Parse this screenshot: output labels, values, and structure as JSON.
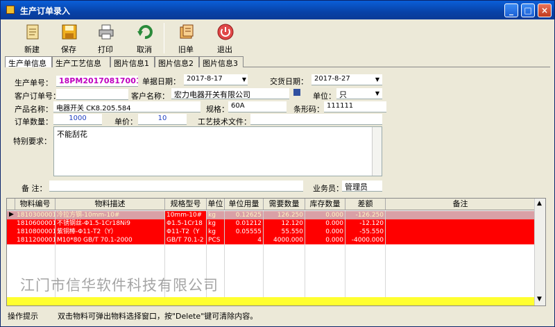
{
  "window": {
    "title": "生产订单录入"
  },
  "toolbar": {
    "buttons": [
      {
        "label": "新建",
        "icon": "new-doc-icon"
      },
      {
        "label": "保存",
        "icon": "floppy-save-icon"
      },
      {
        "label": "打印",
        "icon": "printer-icon"
      },
      {
        "label": "取消",
        "icon": "undo-arrows-icon"
      },
      {
        "label": "旧单",
        "icon": "old-order-icon"
      },
      {
        "label": "退出",
        "icon": "power-exit-icon"
      }
    ]
  },
  "tabs": [
    "生产单信息",
    "生产工艺信息",
    "图片信息1",
    "图片信息2",
    "图片信息3"
  ],
  "form": {
    "order_no_label": "生产单号：",
    "order_no": "18PM20170817001",
    "order_date_label": "单据日期：",
    "order_date": "2017-8-17",
    "delivery_date_label": "交货日期：",
    "delivery_date": "2017-8-27",
    "customer_order_label": "客户订单号：",
    "customer_order": "",
    "customer_name_label": "客户名称：",
    "customer_name": "宏力电器开关有限公司",
    "unit_label": "单位：",
    "unit": "只",
    "product_name_label": "产品名称：",
    "product_name": "电器开关 CK8.205.584",
    "spec_label": "规格：",
    "spec": "60A",
    "barcode_label": "条形码：",
    "barcode": "111111",
    "quantity_label": "订单数量：",
    "quantity": "1000",
    "price_label": "单价：",
    "price": "10",
    "process_file_label": "工艺技术文件：",
    "process_file": "",
    "special_label": "特别要求：",
    "special": "不能刮花",
    "remark_label": "备  注：",
    "remark": "",
    "salesman_label": "业务员：",
    "salesman": "管理员"
  },
  "grid": {
    "headers": [
      "物料编号",
      "物料描述",
      "规格型号",
      "单位",
      "单位用量",
      "需要数量",
      "库存数量",
      "差额",
      "备注"
    ],
    "rows": [
      [
        "1810300001",
        "冷拉方钢-10mm-10#",
        "10mm-10#",
        "kg",
        "0.12625",
        "126.250",
        "0.000",
        "-126.250",
        ""
      ],
      [
        "1810600001",
        "不锈钢丝-Φ1.5-1Cr18Ni9",
        "Φ1.5-1Cr18",
        "kg",
        "0.01212",
        "12.120",
        "0.000",
        "-12.120",
        ""
      ],
      [
        "1810800001",
        "紫铜棒-Φ11-T2（Y）",
        "Φ11-T2（Y",
        "kg",
        "0.05555",
        "55.550",
        "0.000",
        "-55.550",
        ""
      ],
      [
        "1811200001",
        "M10*80 GB/T 70.1-2000",
        "GB/T 70.1-2",
        "PCS",
        "4",
        "4000.000",
        "0.000",
        "-4000.000",
        ""
      ]
    ]
  },
  "status": {
    "left": "操作提示",
    "hint": "双击物料可弹出物料选择窗口，按\"Delete\"键可清除内容。"
  },
  "watermark": "江门市信华软件科技有限公司",
  "colors": {
    "title_bar": "#0a4fc8",
    "selected_row": "#d9a0a6",
    "alert_row": "#ff0000",
    "order_no": "#c000c0"
  }
}
